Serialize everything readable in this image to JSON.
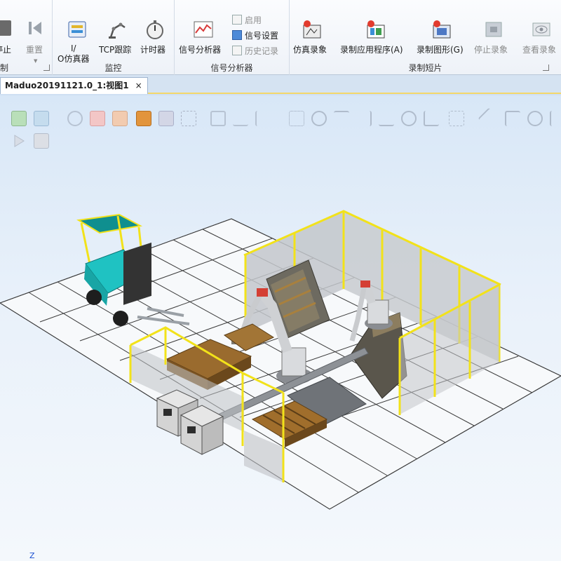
{
  "ribbon": {
    "groups": [
      {
        "label": "制"
      },
      {
        "label": "监控"
      },
      {
        "label": "信号分析器"
      },
      {
        "label": "录制短片"
      }
    ],
    "buttons": {
      "stop": "停止",
      "reset": "重置",
      "io_sim_line1": "I/",
      "io_sim_line2": "O仿真器",
      "tcp_trace": "TCP跟踪",
      "timer": "计时器",
      "signal_analyzer": "信号分析器",
      "enable": "启用",
      "signal_setup": "信号设置",
      "history": "历史记录",
      "sim_record": "仿真录象",
      "record_app": "录制应用程序(A)",
      "record_graphics": "录制图形(G)",
      "stop_record": "停止录象",
      "view_record": "查看录象"
    }
  },
  "document_tab": {
    "title": "Maduo20191121.0_1:视图1",
    "close": "×"
  },
  "viewport": {
    "axis_label": "Z"
  },
  "colors": {
    "fence": "#f2e21a",
    "floor_grid": "#2b2b2b",
    "forklift": "#1fc2c2",
    "pallet": "#9a6b2e",
    "panel": "#c8c8c8"
  }
}
